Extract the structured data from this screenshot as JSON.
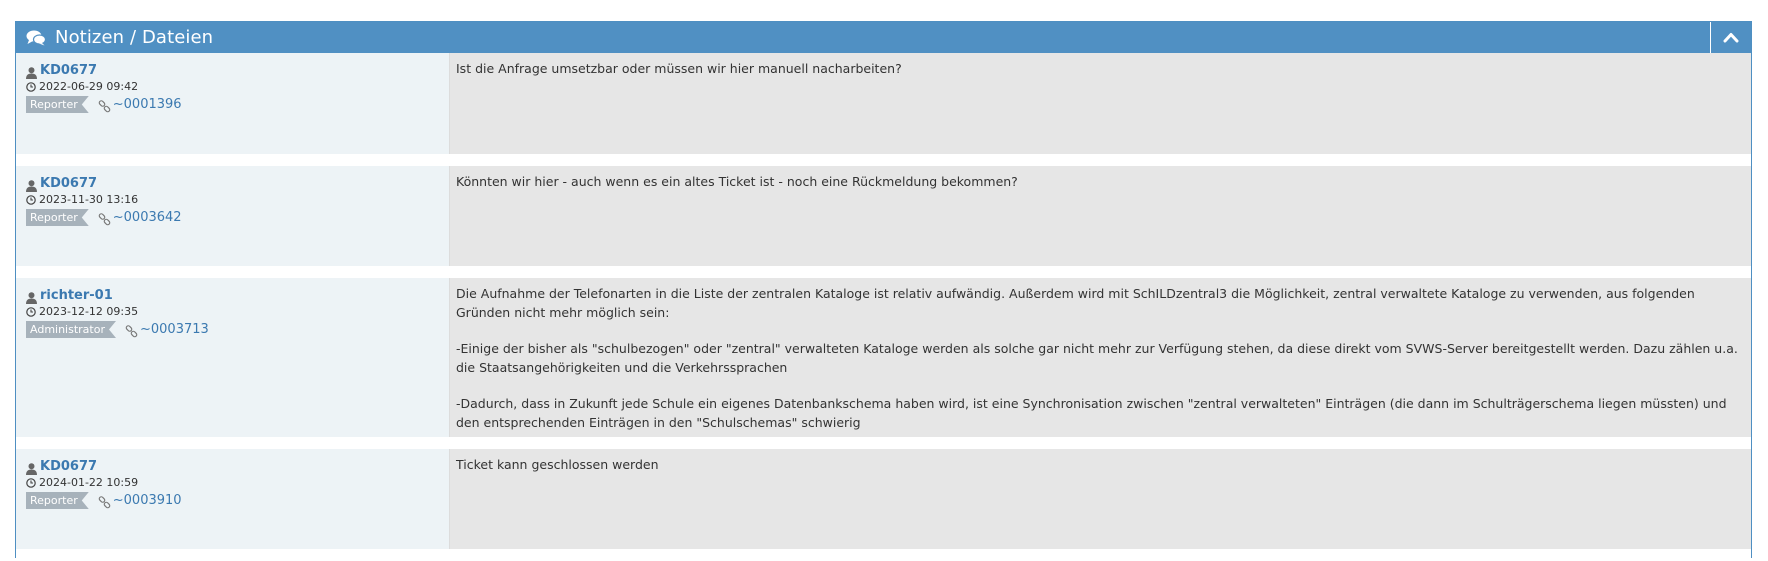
{
  "widget": {
    "title": "Notizen / Dateien",
    "title_icon": "comments-icon",
    "collapse_icon": "chevron-up-icon"
  },
  "colors": {
    "header": "#5090c3",
    "left_panel": "#edf3f6",
    "right_panel": "#e6e6e6",
    "link": "#3b79b0",
    "badge": "#a7b2bb"
  },
  "notes": [
    {
      "author": "KD0677",
      "date": "2022-06-29 09:42",
      "role": "Reporter",
      "link": "~0001396",
      "paragraphs": [
        "Ist die Anfrage umsetzbar oder müssen wir hier manuell nacharbeiten?"
      ]
    },
    {
      "author": "KD0677",
      "date": "2023-11-30 13:16",
      "role": "Reporter",
      "link": "~0003642",
      "paragraphs": [
        "Könnten wir hier - auch wenn es ein altes Ticket ist - noch eine Rückmeldung bekommen?"
      ]
    },
    {
      "author": "richter-01",
      "date": "2023-12-12 09:35",
      "role": "Administrator",
      "link": "~0003713",
      "paragraphs": [
        "Die Aufnahme der Telefonarten in die Liste der zentralen Kataloge ist relativ aufwändig. Außerdem wird mit SchILDzentral3 die Möglichkeit, zentral verwaltete Kataloge zu verwenden, aus folgenden Gründen nicht mehr möglich sein:",
        "-Einige der bisher als \"schulbezogen\" oder \"zentral\" verwalteten Kataloge werden als solche gar nicht mehr zur Verfügung stehen, da diese direkt vom SVWS-Server bereitgestellt werden. Dazu zählen u.a. die Staatsangehörigkeiten und die Verkehrssprachen",
        "-Dadurch, dass in Zukunft jede Schule ein eigenes Datenbankschema haben wird, ist eine Synchronisation zwischen \"zentral verwalteten\" Einträgen (die dann im Schulträgerschema liegen müssten) und den entsprechenden Einträgen in den \"Schulschemas\" schwierig"
      ]
    },
    {
      "author": "KD0677",
      "date": "2024-01-22 10:59",
      "role": "Reporter",
      "link": "~0003910",
      "paragraphs": [
        "Ticket kann geschlossen werden"
      ]
    }
  ]
}
